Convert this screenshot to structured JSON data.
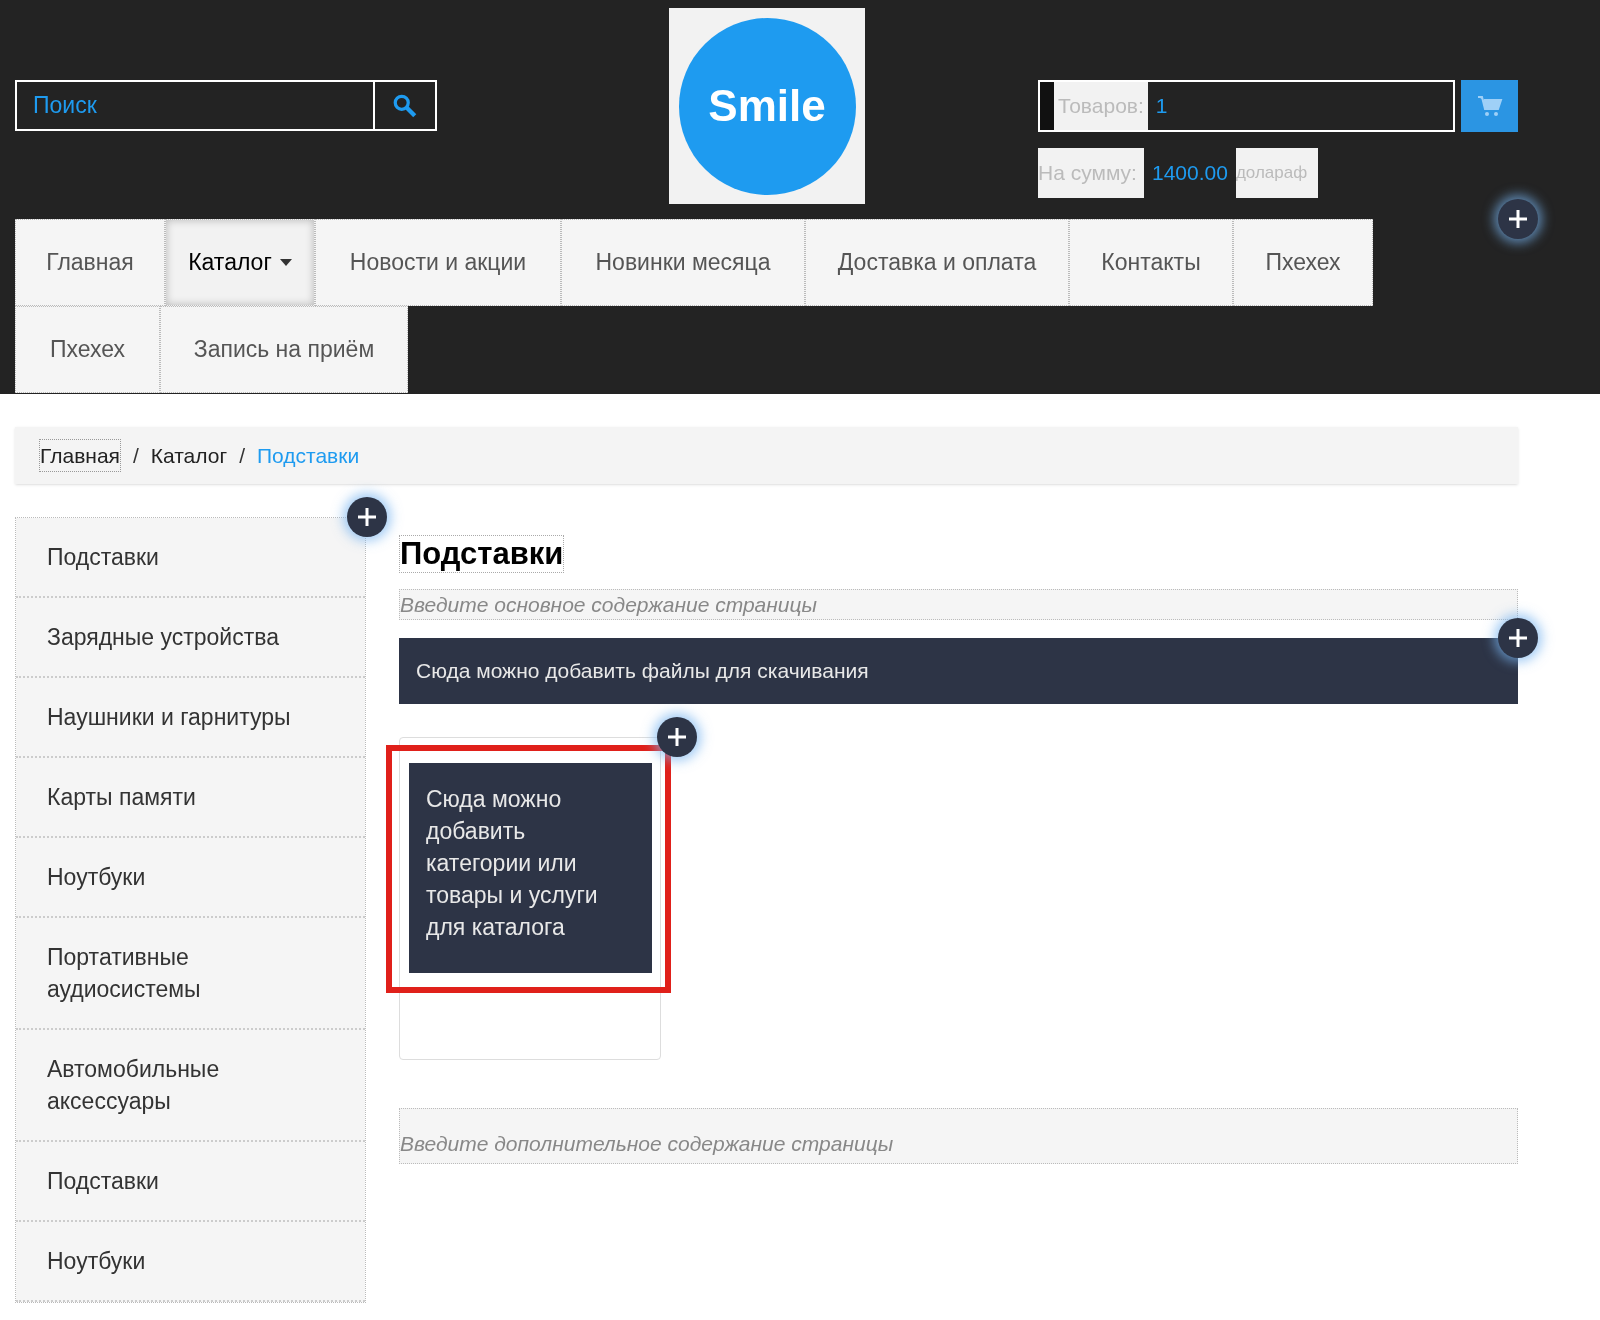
{
  "header": {
    "search": {
      "placeholder": "Поиск"
    },
    "logo": {
      "text": "Smile"
    },
    "cart": {
      "items_label": "Товаров:",
      "items_count": "1",
      "sum_label": "На сумму:",
      "sum_value": "1400.00",
      "currency": "долараф"
    }
  },
  "nav": [
    {
      "label": "Главная",
      "selected": false,
      "dropdown": false
    },
    {
      "label": "Каталог",
      "selected": true,
      "dropdown": true
    },
    {
      "label": "Новости и акции",
      "selected": false,
      "dropdown": false
    },
    {
      "label": "Новинки месяца",
      "selected": false,
      "dropdown": false
    },
    {
      "label": "Доставка и оплата",
      "selected": false,
      "dropdown": false
    },
    {
      "label": "Контакты",
      "selected": false,
      "dropdown": false
    },
    {
      "label": "Пхехех",
      "selected": false,
      "dropdown": false
    },
    {
      "label": "Пхехех",
      "selected": false,
      "dropdown": false
    },
    {
      "label": "Запись на приём",
      "selected": false,
      "dropdown": false
    }
  ],
  "breadcrumb": [
    {
      "label": "Главная",
      "current": false
    },
    {
      "label": "Каталог",
      "current": false
    },
    {
      "label": "Подставки",
      "current": true
    }
  ],
  "breadcrumb_separator": "/",
  "sidebar": {
    "items": [
      "Подставки",
      "Зарядные устройства",
      "Наушники и гарнитуры",
      "Карты памяти",
      "Ноутбуки",
      "Портативные аудиосистемы",
      "Автомобильные аксессуары",
      "Подставки",
      "Ноутбуки"
    ]
  },
  "content": {
    "title": "Подставки",
    "main_placeholder": "Введите основное содержание страницы",
    "files_banner": "Сюда можно добавить файлы для скачивания",
    "catalog_card": "Сюда можно добавить категории или товары и услуги для каталога",
    "extra_placeholder": "Введите дополнительное содержание страницы"
  }
}
